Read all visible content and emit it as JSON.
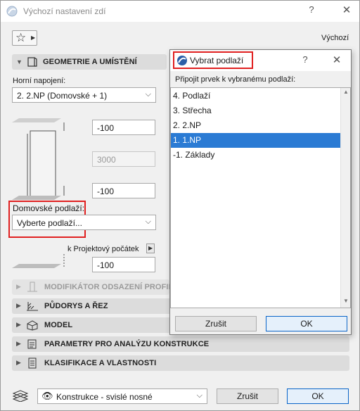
{
  "window": {
    "title": "Výchozí nastavení zdí"
  },
  "toolbar": {
    "favorites_label": "Výchozí"
  },
  "geometry": {
    "header": "GEOMETRIE A UMÍSTĚNÍ",
    "top_link_label": "Horní napojení:",
    "top_link_value": "2. 2.NP (Domovské + 1)",
    "top_offset": "-100",
    "height": "3000",
    "bottom_offset": "-100",
    "home_story_label": "Domovské podlaží:",
    "home_story_value": "Vyberte podlaží...",
    "ref_label": "k Projektový počátek",
    "ref_value": "-100"
  },
  "sections": [
    {
      "label": "MODIFIKÁTOR ODSAZENÍ PROFILU",
      "icon": "profile-offset-icon",
      "disabled": true
    },
    {
      "label": "PŮDORYS A ŘEZ",
      "icon": "floor-plan-icon",
      "disabled": false
    },
    {
      "label": "MODEL",
      "icon": "model-icon",
      "disabled": false
    },
    {
      "label": "PARAMETRY PRO ANALÝZU KONSTRUKCE",
      "icon": "structural-analysis-icon",
      "disabled": false
    },
    {
      "label": "KLASIFIKACE A VLASTNOSTI",
      "icon": "classification-icon",
      "disabled": false
    }
  ],
  "footer": {
    "layer_value": "Konstrukce - svislé nosné",
    "cancel_label": "Zrušit",
    "ok_label": "OK"
  },
  "dialog": {
    "title": "Vybrat podlaží",
    "help_label": "?",
    "close_label": "✕",
    "instruction": "Připojit prvek k vybranému podlaží:",
    "stories": [
      "4. Podlaží",
      "3. Střecha",
      "2. 2.NP",
      "1. 1.NP",
      "-1. Základy"
    ],
    "selected_index": 3,
    "cancel_label": "Zrušit",
    "ok_label": "OK"
  },
  "colors": {
    "selection": "#2b7bd4",
    "highlight_border": "#e02020",
    "primary_border": "#0a64c8"
  }
}
